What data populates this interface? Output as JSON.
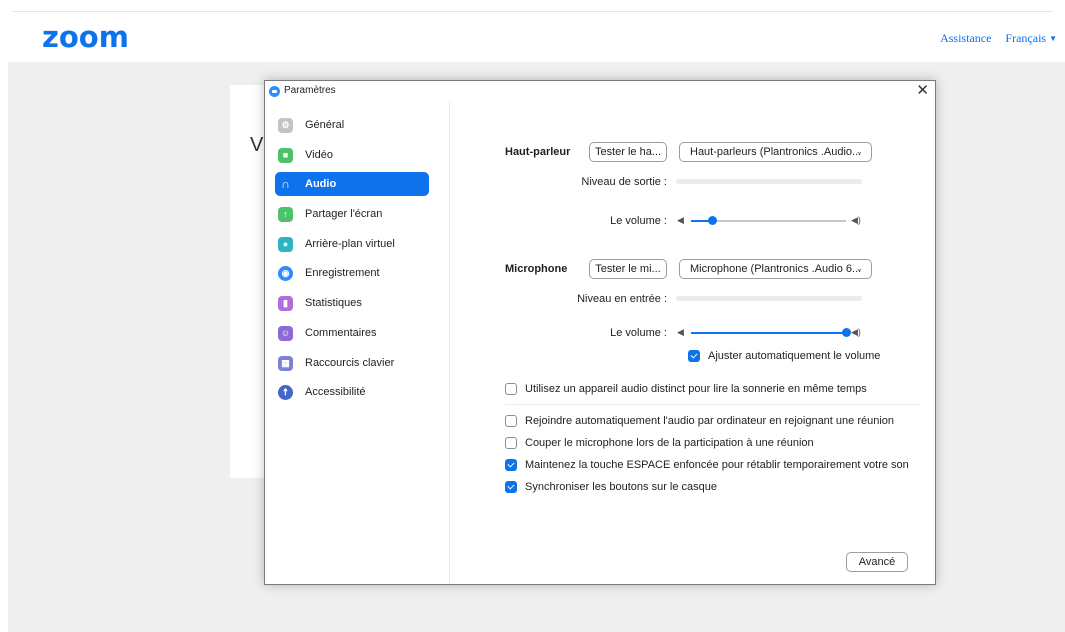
{
  "brand": {
    "logo_text": "zoom",
    "color": "#0e72ed"
  },
  "top_links": {
    "support": "Assistance",
    "language": "Français"
  },
  "background_card_letter": "V",
  "dialog": {
    "title": "Paramètres",
    "close": "✕",
    "sidebar": {
      "items": [
        {
          "label": "Général",
          "icon": "gear-icon",
          "color": "#b3b3b3"
        },
        {
          "label": "Vidéo",
          "icon": "video-camera-icon",
          "color": "#4cc36b"
        },
        {
          "label": "Audio",
          "icon": "headphones-icon",
          "color": "#0e72ed",
          "active": true
        },
        {
          "label": "Partager l'écran",
          "icon": "share-screen-icon",
          "color": "#4cc36b"
        },
        {
          "label": "Arrière-plan virtuel",
          "icon": "person-background-icon",
          "color": "#2bb5c4"
        },
        {
          "label": "Enregistrement",
          "icon": "record-icon",
          "color": "#2d8cff"
        },
        {
          "label": "Statistiques",
          "icon": "bar-chart-icon",
          "color": "#b16ed6"
        },
        {
          "label": "Commentaires",
          "icon": "smiley-icon",
          "color": "#8d6bd6"
        },
        {
          "label": "Raccourcis clavier",
          "icon": "keyboard-icon",
          "color": "#7b82d6"
        },
        {
          "label": "Accessibilité",
          "icon": "accessibility-icon",
          "color": "#4367c9"
        }
      ]
    },
    "speaker": {
      "label": "Haut-parleur",
      "test_button": "Tester le ha...",
      "device": "Haut-parleurs (Plantronics .Audio...",
      "output_level_label": "Niveau de sortie :",
      "volume_label": "Le volume :",
      "volume": 0.14
    },
    "microphone": {
      "label": "Microphone",
      "test_button": "Tester le mi...",
      "device": "Microphone (Plantronics .Audio 6...",
      "input_level_label": "Niveau en entrée :",
      "volume_label": "Le volume :",
      "volume": 1.0,
      "auto_adjust": {
        "label": "Ajuster automatiquement le volume",
        "checked": true
      }
    },
    "options": [
      {
        "label": "Utilisez un appareil audio distinct pour lire la sonnerie en même temps",
        "checked": false
      },
      {
        "label": "Rejoindre automatiquement l'audio par ordinateur en rejoignant une réunion",
        "checked": false
      },
      {
        "label": "Couper le microphone lors de la participation à une réunion",
        "checked": false
      },
      {
        "label": "Maintenez la touche ESPACE enfoncée pour rétablir temporairement votre son",
        "checked": true
      },
      {
        "label": "Synchroniser les boutons sur le casque",
        "checked": true
      }
    ],
    "advanced_button": "Avancé"
  }
}
